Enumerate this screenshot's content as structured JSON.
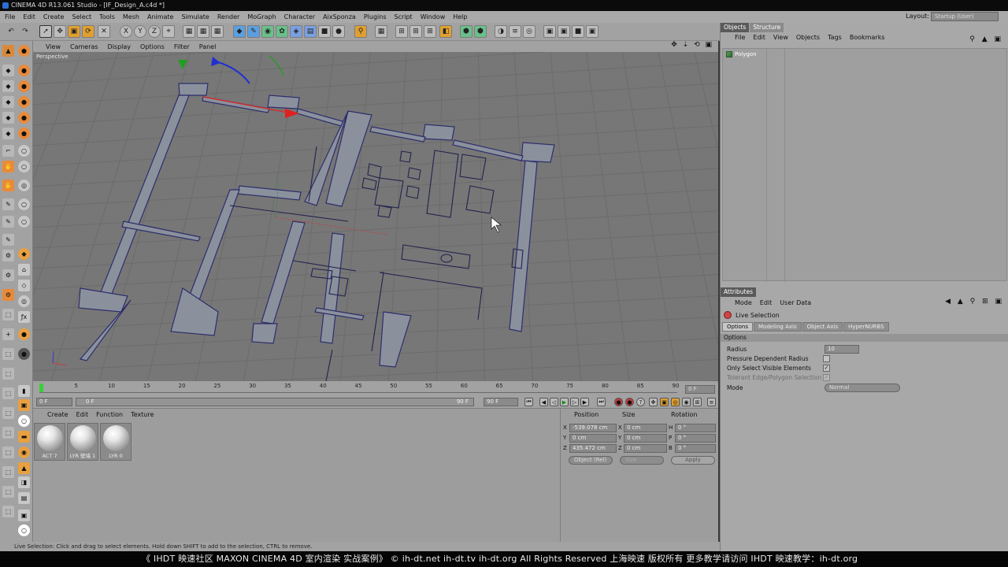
{
  "window": {
    "title": "CINEMA 4D R13.061 Studio - [IF_Design_A.c4d *]"
  },
  "menubar": [
    "File",
    "Edit",
    "Create",
    "Select",
    "Tools",
    "Mesh",
    "Animate",
    "Simulate",
    "Render",
    "MoGraph",
    "Character",
    "AixSponza",
    "Plugins",
    "Script",
    "Window",
    "Help"
  ],
  "layout": {
    "label": "Layout:",
    "value": "Startup (User)"
  },
  "toolbar": {
    "axis_x": "X",
    "axis_y": "Y",
    "axis_z": "Z"
  },
  "viewport": {
    "menu": [
      "View",
      "Cameras",
      "Display",
      "Options",
      "Filter",
      "Panel"
    ],
    "camera_label": "Perspective",
    "nav_icons": "✥ ⇣ ⟲ ▣"
  },
  "timeline": {
    "ticks": [
      "0",
      "5",
      "10",
      "15",
      "20",
      "25",
      "30",
      "35",
      "40",
      "45",
      "50",
      "55",
      "60",
      "65",
      "70",
      "75",
      "80",
      "85",
      "90"
    ],
    "current_frame": "0 F"
  },
  "transport": {
    "start": "0 F",
    "range_start": "0 F",
    "range_end": "90 F",
    "end": "90 F"
  },
  "materials": {
    "menu": [
      "Create",
      "Edit",
      "Function",
      "Texture"
    ],
    "items": [
      {
        "label": "ACT 7"
      },
      {
        "label": "LYR 壁墙 1"
      },
      {
        "label": "LYR 0"
      }
    ]
  },
  "coordinates": {
    "headers": {
      "position": "Position",
      "size": "Size",
      "rotation": "Rotation"
    },
    "rows": [
      {
        "axis": "X",
        "pos": "-539.078 cm",
        "size_axis": "X",
        "size": "0 cm",
        "rot_axis": "H",
        "rot": "0 °"
      },
      {
        "axis": "Y",
        "pos": "0 cm",
        "size_axis": "Y",
        "size": "0 cm",
        "rot_axis": "P",
        "rot": "0 °"
      },
      {
        "axis": "Z",
        "pos": "435.472 cm",
        "size_axis": "Z",
        "size": "0 cm",
        "rot_axis": "B",
        "rot": "0 °"
      }
    ],
    "mode": "Object (Rel)",
    "size_mode": "Size",
    "apply": "Apply"
  },
  "objects": {
    "tabs": [
      "Objects",
      "Structure"
    ],
    "menu": [
      "File",
      "Edit",
      "View",
      "Objects",
      "Tags",
      "Bookmarks"
    ],
    "items": [
      {
        "name": "Polygon"
      }
    ]
  },
  "attributes": {
    "tab": "Attributes",
    "menu": [
      "Mode",
      "Edit",
      "User Data"
    ],
    "tool": "Live Selection",
    "subtabs": [
      "Options",
      "Modeling Axis",
      "Object Axis",
      "HyperNURBS"
    ],
    "section": "Options",
    "radius_label": "Radius",
    "radius": "10",
    "pressure_label": "Pressure Dependent Radius",
    "pressure": false,
    "visible_label": "Only Select Visible Elements",
    "visible": true,
    "tolerant_label": "Tolerant Edge/Polygon Selection",
    "tolerant": true,
    "mode_label": "Mode",
    "mode": "Normal"
  },
  "status": "Live Selection: Click and drag to select elements. Hold down SHIFT to add to the selection, CTRL to remove.",
  "watermark": "《 IHDT 映速社区 MAXON CINEMA 4D 室内渲染 实战案例》  © ih-dt.net ih-dt.tv  ih-dt.org  All Rights Reserved 上海映速 版权所有     更多教学请访问 IHDT 映速教学：ih-dt.org",
  "colors": {
    "wire": "#2a2a6a",
    "grid": "#6c6c6c",
    "viewport_bg": "#777777",
    "panel": "#a2a2a2"
  }
}
